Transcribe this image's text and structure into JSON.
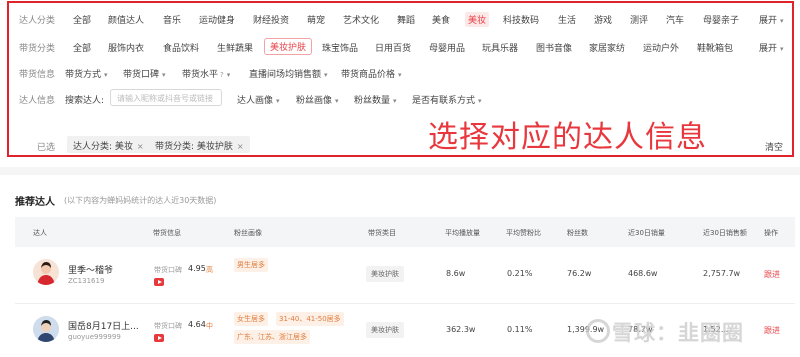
{
  "filters": {
    "talent_category": {
      "label": "达人分类",
      "items": [
        "全部",
        "颜值达人",
        "音乐",
        "运动健身",
        "财经投资",
        "萌宠",
        "艺术文化",
        "舞蹈",
        "美食",
        "美妆",
        "科技数码",
        "生活",
        "游戏",
        "测评",
        "汽车",
        "母婴亲子"
      ],
      "active": "美妆",
      "expand": "展开"
    },
    "goods_category": {
      "label": "带货分类",
      "items": [
        "全部",
        "服饰内衣",
        "食品饮料",
        "生鲜蔬果",
        "美妆护肤",
        "珠宝饰品",
        "日用百货",
        "母婴用品",
        "玩具乐器",
        "图书音像",
        "家居家纺",
        "运动户外",
        "鞋靴箱包"
      ],
      "active": "美妆护肤",
      "expand": "展开"
    },
    "goods_info": {
      "label": "带货信息",
      "dropdowns": [
        "带货方式",
        "带货口碑",
        "带货水平",
        "直播间场均销售额",
        "带货商品价格"
      ],
      "help_glyph": "?"
    },
    "talent_info": {
      "label": "达人信息",
      "search_label": "搜索达人:",
      "search_placeholder": "请输入昵称或抖音号或链接",
      "dropdowns": [
        "达人画像",
        "粉丝画像",
        "粉丝数量",
        "是否有联系方式"
      ]
    },
    "selected": {
      "label": "已选",
      "tags": [
        "达人分类: 美妆",
        "带货分类: 美妆护肤"
      ],
      "tag_close": "×",
      "clear": "清空"
    },
    "annotation": "选择对应的达人信息"
  },
  "recommend": {
    "title": "推荐达人",
    "note": "(以下内容为蝉妈妈统计的达人近30天数据)",
    "columns": [
      "达人",
      "带货信息",
      "粉丝画像",
      "带货类目",
      "平均播放量",
      "平均赞粉比",
      "粉丝数",
      "近30日销量",
      "近30日销售额",
      "操作"
    ],
    "rows": [
      {
        "name": "里季～稽爷",
        "id": "ZC131619",
        "reputation_label": "带货口碑",
        "reputation_score": "4.95",
        "reputation_level": "高",
        "fan_tags": [
          "男生居多"
        ],
        "category": "美妆护肤",
        "avg_play": "8.6w",
        "like_fan_ratio": "0.21%",
        "fans": "76.2w",
        "sales_30d": "468.6w",
        "revenue_30d": "2,757.7w",
        "action": "跟进"
      },
      {
        "name": "国岳8月17日上...",
        "id": "guoyue999999",
        "reputation_label": "带货口碑",
        "reputation_score": "4.64",
        "reputation_level": "中",
        "fan_tags": [
          "女生居多",
          "31-40、41-50居多",
          "广东、江苏、浙江居多"
        ],
        "category": "美妆护肤",
        "avg_play": "362.3w",
        "like_fan_ratio": "0.11%",
        "fans": "1,399.9w",
        "sales_30d": "78.7w",
        "revenue_30d": "1.52...",
        "action": "跟进"
      }
    ]
  },
  "watermark": "雪球：韭圈圈",
  "colors": {
    "accent": "#e8444a",
    "annotation_border": "#e0232b"
  }
}
